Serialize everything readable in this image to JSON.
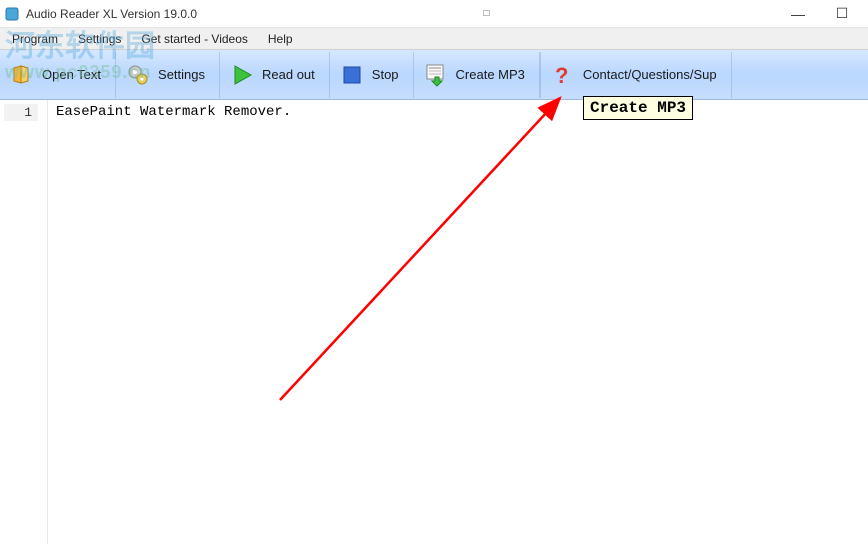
{
  "titlebar": {
    "title": "Audio Reader XL Version 19.0.0",
    "center_glyph": "□",
    "minimize": "—",
    "maximize": "☐"
  },
  "menubar": {
    "items": [
      {
        "label": "Program"
      },
      {
        "label": "Settings"
      },
      {
        "label": "Get started - Videos"
      },
      {
        "label": "Help"
      }
    ]
  },
  "toolbar": {
    "open_text": "Open Text",
    "settings": "Settings",
    "read_out": "Read out",
    "stop": "Stop",
    "create_mp3": "Create MP3",
    "contact": "Contact/Questions/Sup"
  },
  "editor": {
    "line_number": "1",
    "content": "EasePaint Watermark Remover."
  },
  "tooltip": {
    "text": "Create MP3"
  },
  "watermark": {
    "main": "河东软件园",
    "sub": "www.pc0359.cn"
  }
}
